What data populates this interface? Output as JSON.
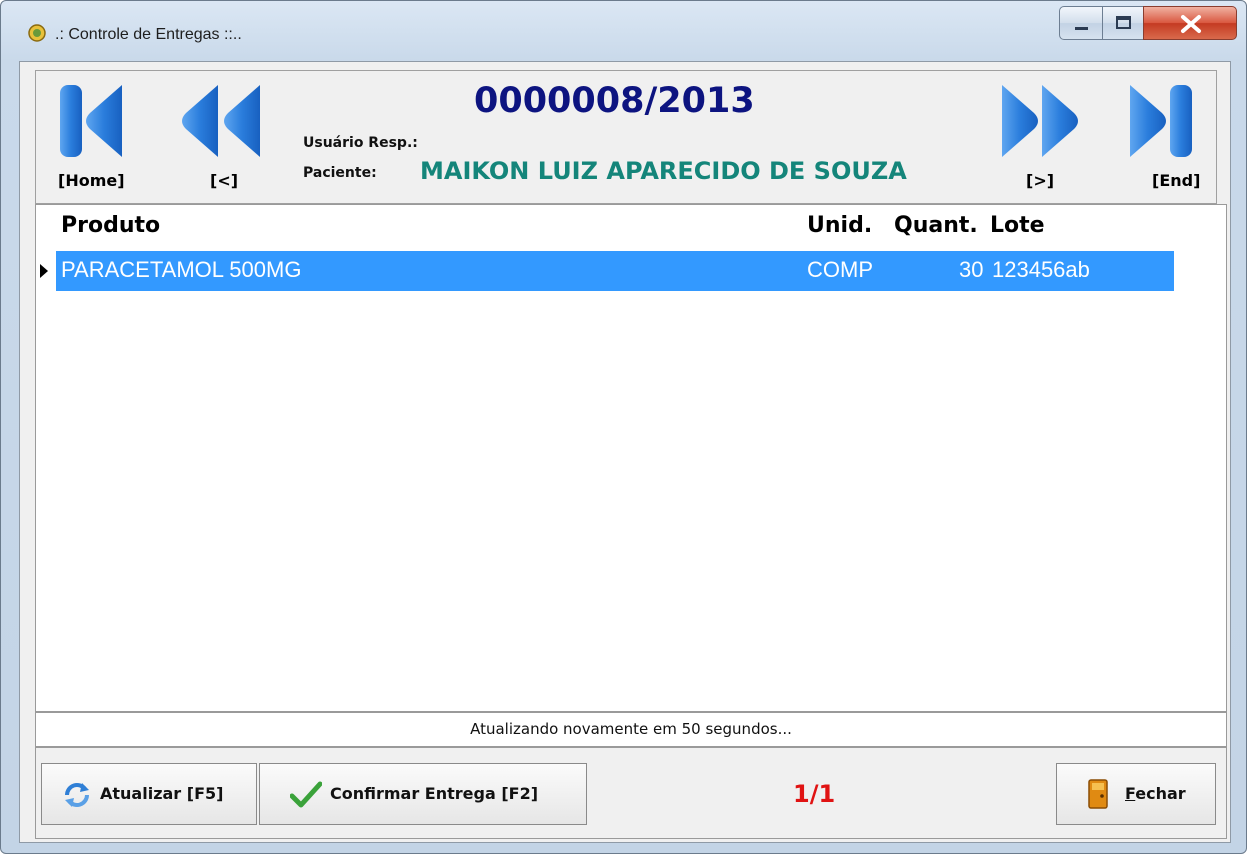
{
  "window": {
    "title": ".: Controle de Entregas ::..",
    "controls": [
      "minimize",
      "maximize",
      "close"
    ]
  },
  "header": {
    "document_number": "0000008/2013",
    "usuario_label": "Usuário Resp.:",
    "usuario_value": "",
    "paciente_label": "Paciente:",
    "paciente_value": "MAIKON LUIZ APARECIDO DE SOUZA",
    "nav": {
      "first_label": "[Home]",
      "prev_label": "[<]",
      "next_label": "[>]",
      "last_label": "[End]"
    }
  },
  "grid": {
    "columns": [
      "Produto",
      "Unid.",
      "Quant.",
      "Lote"
    ],
    "rows": [
      {
        "produto": "PARACETAMOL 500MG",
        "unid": "COMP",
        "quant": "30",
        "lote": "123456ab",
        "selected": true
      }
    ]
  },
  "status": {
    "text": "Atualizando novamente em 50 segundos..."
  },
  "footer": {
    "refresh_label": "Atualizar [F5]",
    "confirm_label": "Confirmar Entrega [F2]",
    "page_counter": "1/1",
    "close_label": "Fechar"
  },
  "colors": {
    "nav_blue": "#1f73d6",
    "doc_number": "#0d1480",
    "patient": "#14857a",
    "selection": "#3399ff",
    "counter": "#e01313"
  }
}
